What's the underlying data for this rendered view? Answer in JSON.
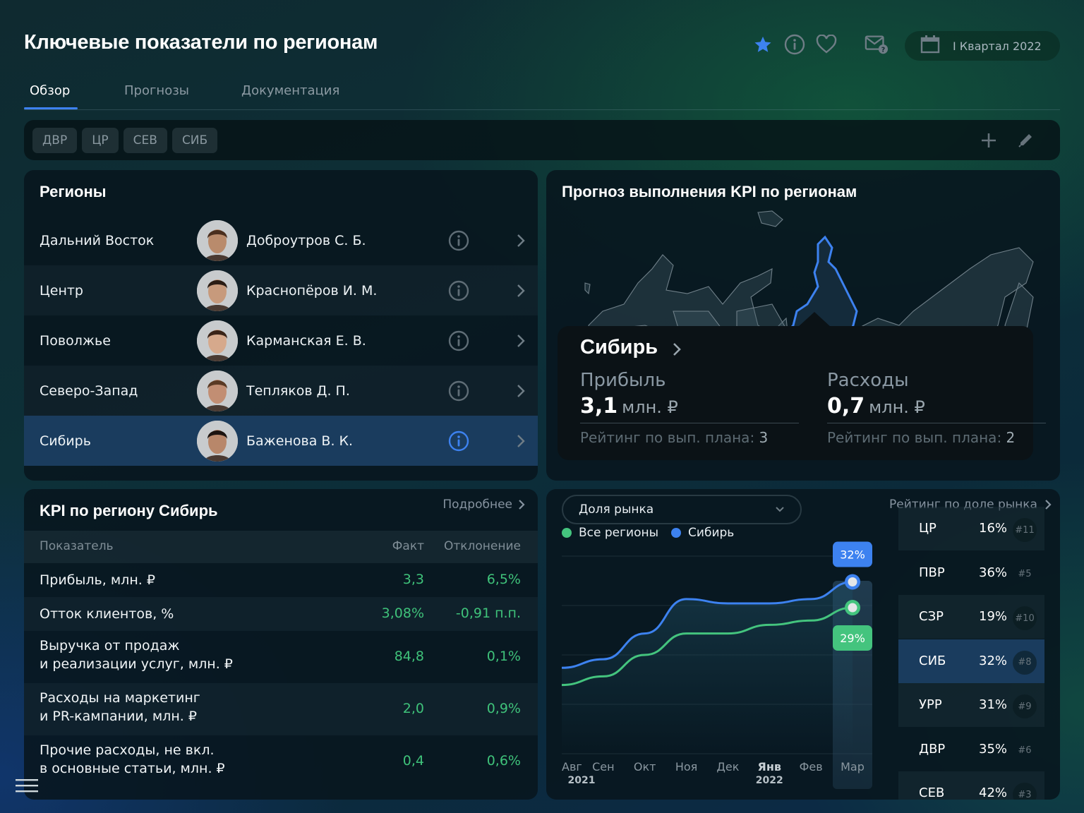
{
  "header": {
    "title": "Ключевые показатели по регионам",
    "icons": [
      "star-icon",
      "info-icon",
      "heart-icon",
      "mail-question-icon"
    ],
    "period_label": "I Квартал 2022",
    "accent_color": "#3d82f0"
  },
  "tabs": [
    {
      "label": "Обзор",
      "active": true
    },
    {
      "label": "Прогнозы",
      "active": false
    },
    {
      "label": "Документация",
      "active": false
    }
  ],
  "filters": {
    "chips": [
      "ДВР",
      "ЦР",
      "СЕВ",
      "СИБ"
    ],
    "add_icon": "plus-icon",
    "edit_icon": "pencil-icon"
  },
  "regions": {
    "title": "Регионы",
    "items": [
      {
        "region": "Дальний Восток",
        "manager": "Доброутров С. Б.",
        "selected": false
      },
      {
        "region": "Центр",
        "manager": "Краснопёров И. М.",
        "selected": false
      },
      {
        "region": "Поволжье",
        "manager": "Карманская Е. В.",
        "selected": false
      },
      {
        "region": "Северо-Запад",
        "manager": "Тепляков Д. П.",
        "selected": false
      },
      {
        "region": "Сибирь",
        "manager": "Баженова В. К.",
        "selected": true
      }
    ]
  },
  "forecast": {
    "title": "Прогноз выполнения KPI по регионам",
    "highlighted_region": "Сибирь",
    "tooltip": {
      "region": "Сибирь",
      "profit": {
        "label": "Прибыль",
        "value": "3,1",
        "unit": "млн. ₽",
        "rank_label": "Рейтинг по вып. плана:",
        "rank": "3"
      },
      "expenses": {
        "label": "Расходы",
        "value": "0,7",
        "unit": "млн. ₽",
        "rank_label": "Рейтинг по вып. плана:",
        "rank": "2"
      }
    }
  },
  "kpi": {
    "title": "KPI по региону Сибирь",
    "more_label": "Подробнее",
    "columns": [
      "Показатель",
      "Факт",
      "Отклонение"
    ],
    "rows": [
      {
        "label": "Прибыль, млн. ₽",
        "fact": "3,3",
        "deviation": "6,5%"
      },
      {
        "label": "Отток клиентов, %",
        "fact": "3,08%",
        "deviation": "-0,91 п.п."
      },
      {
        "label": "Выручка от продаж\nи реализации услуг, млн. ₽",
        "fact": "84,8",
        "deviation": "0,1%"
      },
      {
        "label": "Расходы на маркетинг\nи PR-кампании, млн. ₽",
        "fact": "2,0",
        "deviation": "0,9%"
      },
      {
        "label": "Прочие расходы, не вкл.\nв основные статьи, млн. ₽",
        "fact": "0,4",
        "deviation": "0,6%"
      }
    ],
    "positive_color": "#3fc27a"
  },
  "market": {
    "dropdown_value": "Доля рынка",
    "rating_title": "Рейтинг по доле рынка",
    "ratings": [
      {
        "code": "ЦР",
        "share": "16%",
        "rank": "#11",
        "selected": false
      },
      {
        "code": "ПВР",
        "share": "36%",
        "rank": "#5",
        "selected": false
      },
      {
        "code": "СЗР",
        "share": "19%",
        "rank": "#10",
        "selected": false
      },
      {
        "code": "СИБ",
        "share": "32%",
        "rank": "#8",
        "selected": true
      },
      {
        "code": "УРР",
        "share": "31%",
        "rank": "#9",
        "selected": false
      },
      {
        "code": "ДВР",
        "share": "35%",
        "rank": "#6",
        "selected": false
      },
      {
        "code": "СЕВ",
        "share": "42%",
        "rank": "#3",
        "selected": false
      }
    ]
  },
  "chart_data": {
    "type": "line",
    "title": "Доля рынка",
    "x": [
      "Авг",
      "Сен",
      "Окт",
      "Ноя",
      "Дек",
      "Янв",
      "Фев",
      "Мар"
    ],
    "x_sublabels": {
      "Авг": "2021",
      "Янв": "2022"
    },
    "series": [
      {
        "name": "Все регионы",
        "color": "#44c47e",
        "values": [
          20,
          21,
          23.5,
          26,
          26,
          27,
          27.5,
          29
        ]
      },
      {
        "name": "Сибирь",
        "color": "#3d82f0",
        "values": [
          22,
          23,
          26,
          30,
          29.5,
          29.5,
          30,
          32
        ]
      }
    ],
    "highlight_index": 7,
    "highlight_labels": {
      "Сибирь": "32%",
      "Все регионы": "29%"
    },
    "ylim": [
      12,
      35
    ],
    "grid": true,
    "legend": "top-left"
  }
}
